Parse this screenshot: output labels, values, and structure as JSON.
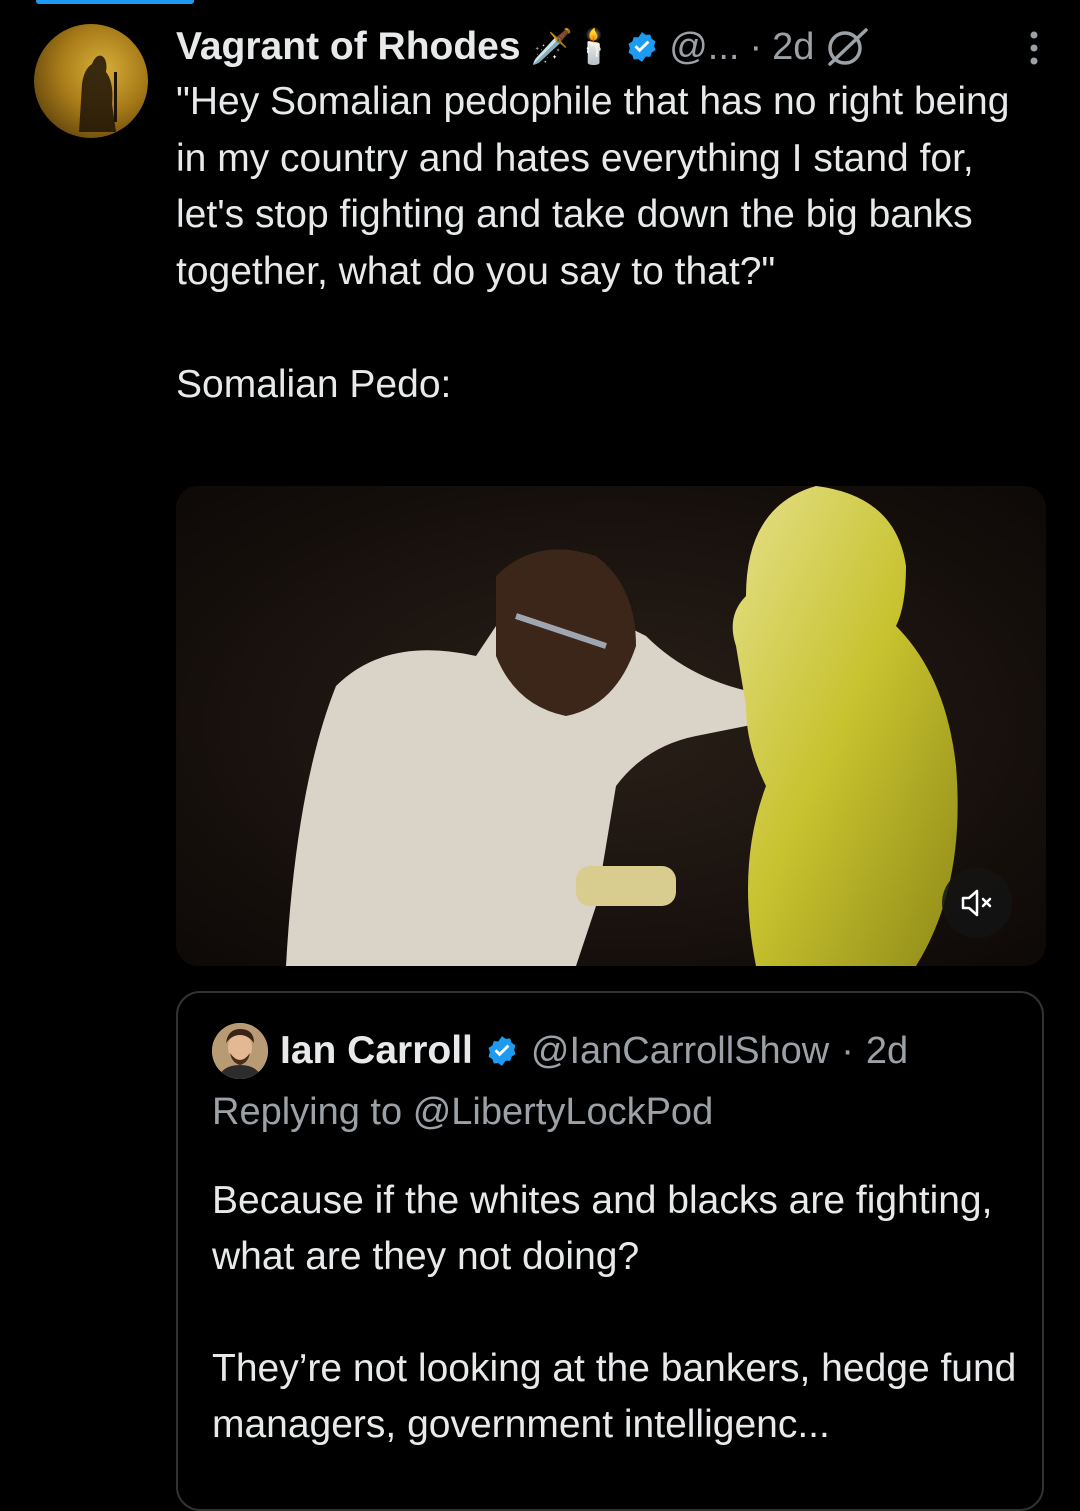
{
  "tweet": {
    "author_name": "Vagrant of Rhodes",
    "name_emojis": "🗡️🕯️",
    "handle": "@...",
    "separator": "·",
    "time": "2d",
    "text": "\"Hey Somalian pedophile that has no right being in my country and hates everything I stand for, let's stop fighting and take down the big banks together, what do you say to that?\"\n\nSomalian Pedo:",
    "icons": {
      "verified": "verified-badge-icon",
      "grok": "grok-icon",
      "more": "more-icon",
      "mute": "volume-mute-icon"
    }
  },
  "quote": {
    "author_name": "Ian Carroll",
    "handle": "@IanCarrollShow",
    "separator": "·",
    "time": "2d",
    "replying_prefix": "Replying to",
    "replying_handle": "@LibertyLockPod",
    "text": "Because if the whites and blacks are fighting, what are they not doing?\n\nThey’re not looking at the bankers, hedge fund managers, government intelligenc..."
  },
  "colors": {
    "accent": "#1d9bf0",
    "background": "#000000",
    "text": "#e7e9ea",
    "muted": "#9ba1a6",
    "border": "#2f3336"
  }
}
